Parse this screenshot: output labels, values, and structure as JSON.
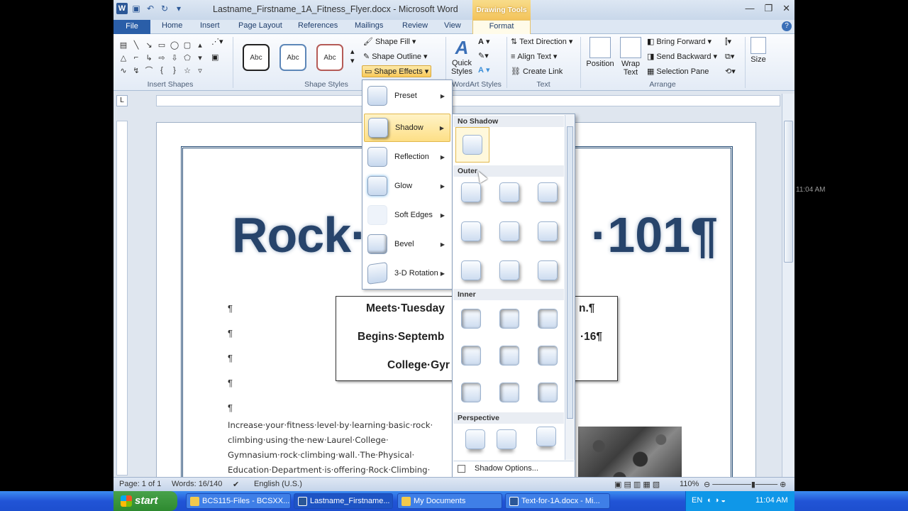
{
  "window": {
    "title": "Lastname_Firstname_1A_Fitness_Flyer.docx - Microsoft Word",
    "contextual_tab_group": "Drawing Tools"
  },
  "tabs": [
    "File",
    "Home",
    "Insert",
    "Page Layout",
    "References",
    "Mailings",
    "Review",
    "View",
    "Format"
  ],
  "ribbon": {
    "groups": {
      "insert_shapes": "Insert Shapes",
      "shape_styles": "Shape Styles",
      "wordart_styles": "WordArt Styles",
      "text": "Text",
      "arrange": "Arrange"
    },
    "style_samples": [
      "Abc",
      "Abc",
      "Abc"
    ],
    "shape_fill": "Shape Fill",
    "shape_outline": "Shape Outline",
    "shape_effects": "Shape Effects",
    "quick_styles": "Quick Styles",
    "text_direction": "Text Direction",
    "align_text": "Align Text",
    "create_link": "Create Link",
    "position": "Position",
    "wrap_text": "Wrap Text",
    "bring_forward": "Bring Forward",
    "send_backward": "Send Backward",
    "selection_pane": "Selection Pane",
    "size": "Size"
  },
  "effects_menu": [
    {
      "label": "Preset"
    },
    {
      "label": "Shadow"
    },
    {
      "label": "Reflection"
    },
    {
      "label": "Glow"
    },
    {
      "label": "Soft Edges"
    },
    {
      "label": "Bevel"
    },
    {
      "label": "3-D Rotation"
    }
  ],
  "shadow_gallery": {
    "no_shadow": "No Shadow",
    "outer": "Outer",
    "inner": "Inner",
    "perspective": "Perspective",
    "options": "Shadow Options..."
  },
  "document": {
    "title_left": "Rock·",
    "title_right": "·101¶",
    "para_mark": "¶",
    "info_lines": [
      "Meets·Tuesday",
      "n.¶",
      "Begins·Septemb",
      "·16¶",
      "College·Gyr"
    ],
    "body": "Increase·your·fitness·level·by·learning·basic·rock· climbing·using·the·new·Laurel·College· Gymnasium·rock·climbing·wall.·The·Physical· Education·Department·is·offering·Rock·Climbing·"
  },
  "status_bar": {
    "page": "Page: 1 of 1",
    "words": "Words: 16/140",
    "language": "English (U.S.)",
    "zoom": "110%"
  },
  "taskbar": {
    "start": "start",
    "tasks": [
      "BCS115-Files - BCSXX...",
      "Lastname_Firstname...",
      "My Documents",
      "Text-for-1A.docx - Mi..."
    ],
    "lang": "EN",
    "time": "11:04 AM"
  }
}
